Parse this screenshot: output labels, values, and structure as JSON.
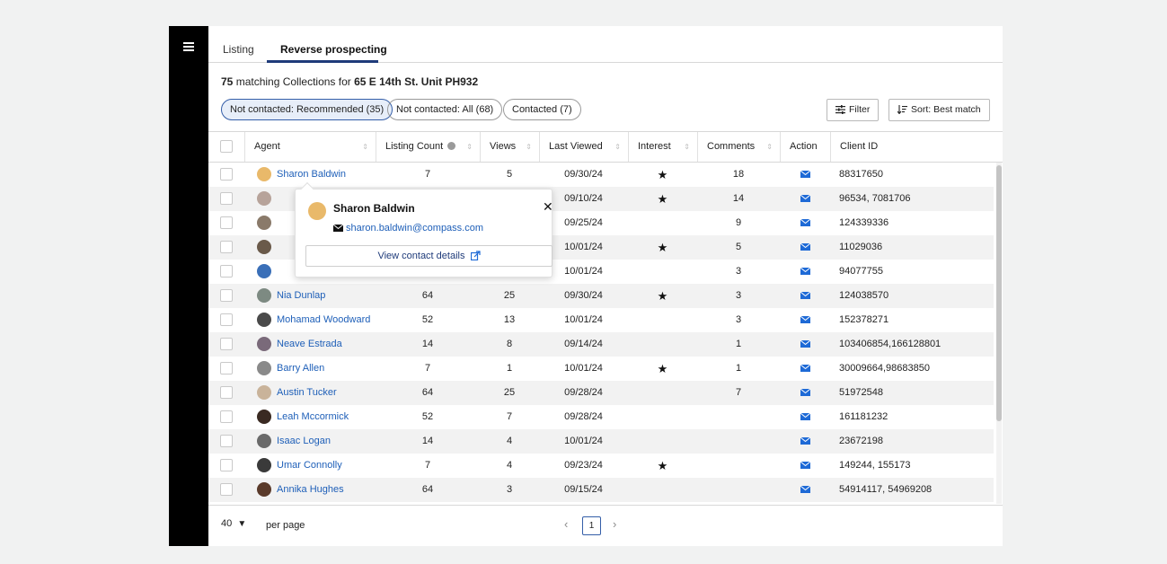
{
  "tabs": [
    {
      "label": "Listing",
      "active": false
    },
    {
      "label": "Reverse prospecting",
      "active": true
    }
  ],
  "summary": {
    "count": "75",
    "text": " matching Collections for ",
    "address": "65 E 14th St. Unit PH932"
  },
  "chips": [
    {
      "label": "Not contacted: Recommended (35)",
      "active": true
    },
    {
      "label": "Not contacted: All (68)",
      "active": false
    },
    {
      "label": "Contacted (7)",
      "active": false
    }
  ],
  "toolbar": {
    "filter_label": "Filter",
    "sort_prefix": "Sort:",
    "sort_value": " Best match"
  },
  "columns": [
    "Agent",
    "Listing Count",
    "Views",
    "Last Viewed",
    "Interest",
    "Comments",
    "Action",
    "Client ID"
  ],
  "rows": [
    {
      "agent": "Sharon Baldwin",
      "listing_count": "7",
      "views": "5",
      "last_viewed": "09/30/24",
      "interest": true,
      "comments": "18",
      "client_id": "88317650",
      "avatar_color": "#e9b96a"
    },
    {
      "agent": "",
      "listing_count": "",
      "views": "",
      "last_viewed": "09/10/24",
      "interest": true,
      "comments": "14",
      "client_id": "96534, 7081706",
      "avatar_color": "#b7a39a"
    },
    {
      "agent": "",
      "listing_count": "",
      "views": "",
      "last_viewed": "09/25/24",
      "interest": false,
      "comments": "9",
      "client_id": "124339336",
      "avatar_color": "#8a7a6a"
    },
    {
      "agent": "",
      "listing_count": "",
      "views": "",
      "last_viewed": "10/01/24",
      "interest": true,
      "comments": "5",
      "client_id": "11029036",
      "avatar_color": "#6a5a4a"
    },
    {
      "agent": "",
      "listing_count": "",
      "views": "",
      "last_viewed": "10/01/24",
      "interest": false,
      "comments": "3",
      "client_id": "94077755",
      "avatar_color": "#3a6fb8"
    },
    {
      "agent": "Nia Dunlap",
      "listing_count": "64",
      "views": "25",
      "last_viewed": "09/30/24",
      "interest": true,
      "comments": "3",
      "client_id": "124038570",
      "avatar_color": "#7d8a82"
    },
    {
      "agent": "Mohamad Woodward",
      "listing_count": "52",
      "views": "13",
      "last_viewed": "10/01/24",
      "interest": false,
      "comments": "3",
      "client_id": "152378271",
      "avatar_color": "#4a4a4a"
    },
    {
      "agent": "Neave Estrada",
      "listing_count": "14",
      "views": "8",
      "last_viewed": "09/14/24",
      "interest": false,
      "comments": "1",
      "client_id": "103406854,166128801",
      "avatar_color": "#7a6a7a"
    },
    {
      "agent": "Barry Allen",
      "listing_count": "7",
      "views": "1",
      "last_viewed": "10/01/24",
      "interest": true,
      "comments": "1",
      "client_id": "30009664,98683850",
      "avatar_color": "#8a8a8a"
    },
    {
      "agent": "Austin Tucker",
      "listing_count": "64",
      "views": "25",
      "last_viewed": "09/28/24",
      "interest": false,
      "comments": "7",
      "client_id": "51972548",
      "avatar_color": "#c9b39a"
    },
    {
      "agent": "Leah Mccormick",
      "listing_count": "52",
      "views": "7",
      "last_viewed": "09/28/24",
      "interest": false,
      "comments": "",
      "client_id": "161181232",
      "avatar_color": "#3a2a22"
    },
    {
      "agent": "Isaac Logan",
      "listing_count": "14",
      "views": "4",
      "last_viewed": "10/01/24",
      "interest": false,
      "comments": "",
      "client_id": "23672198",
      "avatar_color": "#6a6a6a"
    },
    {
      "agent": "Umar Connolly",
      "listing_count": "7",
      "views": "4",
      "last_viewed": "09/23/24",
      "interest": true,
      "comments": "",
      "client_id": "149244, 155173",
      "avatar_color": "#3a3a3a"
    },
    {
      "agent": "Annika Hughes",
      "listing_count": "64",
      "views": "3",
      "last_viewed": "09/15/24",
      "interest": false,
      "comments": "",
      "client_id": "54914117, 54969208",
      "avatar_color": "#5a3a2a"
    }
  ],
  "popover": {
    "name": "Sharon Baldwin",
    "email": "sharon.baldwin@compass.com",
    "button_label": "View contact details"
  },
  "pagination": {
    "per_page": "40",
    "per_page_label": "per page",
    "current_page": "1"
  },
  "colors": {
    "accent": "#1f3b7a",
    "link": "#1e5fb8",
    "mail_icon": "#1e6ad6"
  },
  "icons": {
    "menu": "hamburger-icon",
    "filter": "sliders-icon",
    "sort": "sort-icon",
    "sort_column": "sort-arrows-icon",
    "info": "info-icon",
    "interest": "star-icon",
    "action": "mail-icon",
    "close": "close-icon",
    "external": "external-link-icon",
    "dropdown": "chevron-down-icon",
    "prev": "chevron-left-icon",
    "next": "chevron-right-icon"
  }
}
